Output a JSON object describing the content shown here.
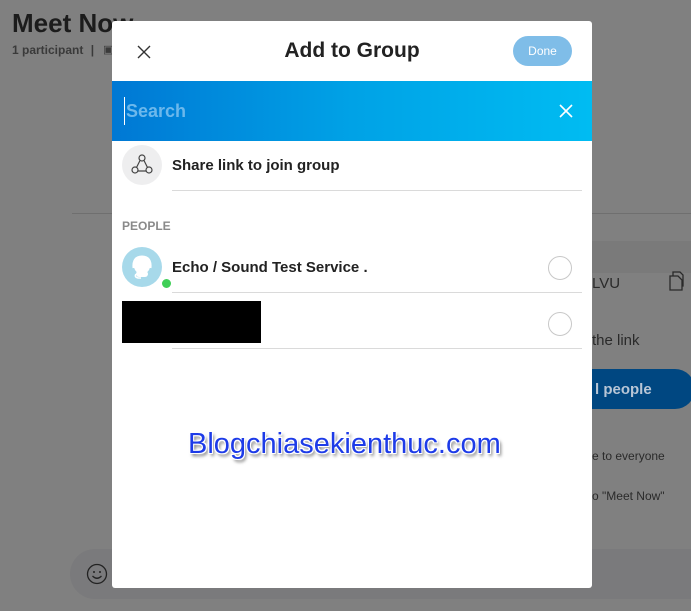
{
  "background": {
    "title": "Meet Now",
    "participants": "1 participant",
    "separator": "|",
    "meeting_code_fragment": "LVU",
    "share_link_fragment": "the link",
    "invite_button_fragment": "l people",
    "info_line_1": "e to everyone",
    "info_line_2": "o \"Meet Now\""
  },
  "dialog": {
    "title": "Add to Group",
    "done_label": "Done",
    "search": {
      "placeholder": "Search",
      "value": ""
    },
    "share_link_label": "Share link to join group",
    "people_header": "PEOPLE",
    "people": [
      {
        "name": "Echo / Sound Test Service .",
        "status": "online",
        "selected": false
      },
      {
        "name": "[redacted]",
        "selected": false
      }
    ]
  },
  "watermark": "Blogchiasekienthuc.com",
  "colors": {
    "accent": "#0078d4",
    "accent_light": "#00bcf2",
    "done_button": "#7fbde8",
    "presence_online": "#3fcf57",
    "invite_button": "#004781"
  }
}
